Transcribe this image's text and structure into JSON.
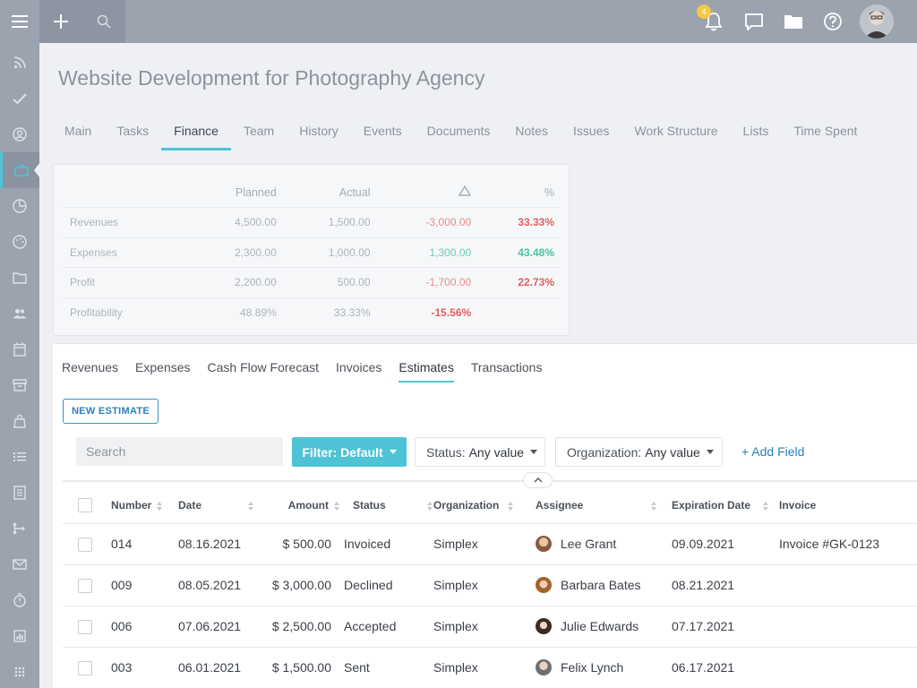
{
  "topbar": {
    "menu_icon": "hamburger-icon",
    "plus_icon": "plus-icon",
    "search_icon": "search-icon",
    "notifications_count": "4",
    "icons": [
      "bell-icon",
      "chat-icon",
      "folder-icon",
      "help-icon"
    ]
  },
  "sidebar": {
    "items": [
      "rss-icon",
      "check-icon",
      "user-icon",
      "briefcase-icon",
      "pie-chart-icon",
      "palette-icon",
      "folder-icon",
      "users-icon",
      "calendar-icon",
      "archive-icon",
      "bag-icon",
      "list-icon",
      "document-icon",
      "flow-icon",
      "mail-icon",
      "timer-icon",
      "report-icon",
      "apps-icon"
    ],
    "active_index": 3
  },
  "page": {
    "title": "Website Development for Photography Agency"
  },
  "tabs": [
    "Main",
    "Tasks",
    "Finance",
    "Team",
    "History",
    "Events",
    "Documents",
    "Notes",
    "Issues",
    "Work Structure",
    "Lists",
    "Time Spent"
  ],
  "active_tab": "Finance",
  "finance": {
    "headers": {
      "planned": "Planned",
      "actual": "Actual",
      "pct": "%"
    },
    "rows": [
      {
        "label": "Revenues",
        "planned": "4,500.00",
        "actual": "1,500.00",
        "delta": "-3,000.00",
        "pct": "33.33%"
      },
      {
        "label": "Expenses",
        "planned": "2,300.00",
        "actual": "1,000.00",
        "delta": "1,300.00",
        "pct": "43.48%"
      },
      {
        "label": "Profit",
        "planned": "2,200.00",
        "actual": "500.00",
        "delta": "-1,700.00",
        "pct": "22.73%"
      },
      {
        "label": "Profitability",
        "planned": "48.89%",
        "actual": "33.33%",
        "delta": "-15.56%",
        "pct": ""
      }
    ]
  },
  "subtabs": [
    "Revenues",
    "Expenses",
    "Cash Flow Forecast",
    "Invoices",
    "Estimates",
    "Transactions"
  ],
  "active_subtab": "Estimates",
  "toolbar": {
    "new_estimate": "NEW ESTIMATE",
    "search_placeholder": "Search",
    "filter_label": "Filter: Default",
    "status_label": "Status:",
    "status_value": "Any value",
    "org_label": "Organization:",
    "org_value": "Any value",
    "add_field": "+ Add Field"
  },
  "table": {
    "headers": {
      "number": "Number",
      "date": "Date",
      "amount": "Amount",
      "status": "Status",
      "organization": "Organization",
      "assignee": "Assignee",
      "expiration": "Expiration Date",
      "invoice": "Invoice"
    },
    "rows": [
      {
        "number": "014",
        "date": "08.16.2021",
        "amount": "$ 500.00",
        "status": "Invoiced",
        "organization": "Simplex",
        "assignee": "Lee Grant",
        "expiration": "09.09.2021",
        "invoice": "Invoice #GK-0123"
      },
      {
        "number": "009",
        "date": "08.05.2021",
        "amount": "$ 3,000.00",
        "status": "Declined",
        "organization": "Simplex",
        "assignee": "Barbara Bates",
        "expiration": "08.21.2021",
        "invoice": ""
      },
      {
        "number": "006",
        "date": "07.06.2021",
        "amount": "$ 2,500.00",
        "status": "Accepted",
        "organization": "Simplex",
        "assignee": "Julie Edwards",
        "expiration": "07.17.2021",
        "invoice": ""
      },
      {
        "number": "003",
        "date": "06.01.2021",
        "amount": "$ 1,500.00",
        "status": "Sent",
        "organization": "Simplex",
        "assignee": "Felix Lynch",
        "expiration": "06.17.2021",
        "invoice": ""
      }
    ]
  },
  "colors": {
    "accent": "#4fc3d6",
    "link": "#2d7fb3",
    "negative": "#e05f5f",
    "positive": "#4ac49d",
    "sidebar": "#9aa3ae"
  }
}
